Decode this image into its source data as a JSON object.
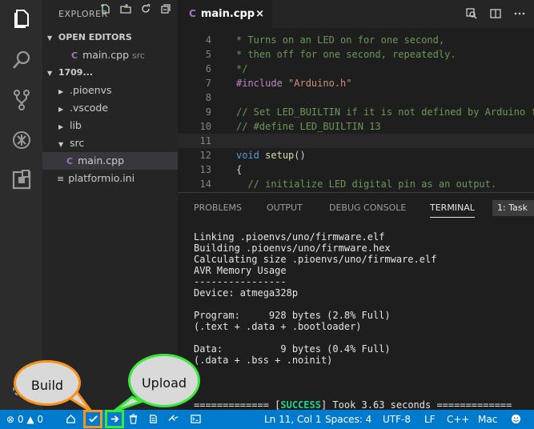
{
  "sidebar": {
    "title": "EXPLORER",
    "open_editors_label": "OPEN EDITORS",
    "open_file": {
      "icon_glyph": "C",
      "name": "main.cpp",
      "folder": "src"
    },
    "project_label": "1709...",
    "tree": [
      {
        "name": ".pioenvs",
        "kind": "folder",
        "expanded": false
      },
      {
        "name": ".vscode",
        "kind": "folder",
        "expanded": false
      },
      {
        "name": "lib",
        "kind": "folder",
        "expanded": false
      },
      {
        "name": "src",
        "kind": "folder",
        "expanded": true
      },
      {
        "name": "main.cpp",
        "kind": "cpp",
        "selected": true
      },
      {
        "name": "platformio.ini",
        "kind": "ini"
      }
    ]
  },
  "tab": {
    "icon_glyph": "C",
    "title": "main.cpp",
    "close": "×"
  },
  "editor": {
    "lines": [
      {
        "n": "4",
        "text": "* Turns on an LED on for one second,",
        "style": "com"
      },
      {
        "n": "5",
        "text": "* then off for one second, repeatedly.",
        "style": "com"
      },
      {
        "n": "6",
        "text": "*/",
        "style": "com"
      },
      {
        "n": "7",
        "text": "",
        "style": "include"
      },
      {
        "n": "8",
        "text": "",
        "style": "plain"
      },
      {
        "n": "9",
        "text": "// Set LED_BUILTIN if it is not defined by Arduino f",
        "style": "com"
      },
      {
        "n": "10",
        "text": "// #define LED_BUILTIN 13",
        "style": "com"
      },
      {
        "n": "11",
        "text": "",
        "style": "plain"
      },
      {
        "n": "12",
        "text": "",
        "style": "setup"
      },
      {
        "n": "13",
        "text": "{",
        "style": "plain"
      },
      {
        "n": "14",
        "text": "  // initialize LED digital pin as an output.",
        "style": "com"
      }
    ],
    "include_kw": "#include",
    "include_str": "\"Arduino.h\"",
    "setup_type": "void",
    "setup_fn": "setup",
    "setup_rest": "()"
  },
  "panel": {
    "tabs": [
      "PROBLEMS",
      "OUTPUT",
      "DEBUG CONSOLE",
      "TERMINAL"
    ],
    "active_tab": "TERMINAL",
    "terminal_select": "1: Task",
    "terminal_lines": [
      "Linking .pioenvs/uno/firmware.elf",
      "Building .pioenvs/uno/firmware.hex",
      "Calculating size .pioenvs/uno/firmware.elf",
      "AVR Memory Usage",
      "----------------",
      "Device: atmega328p",
      "",
      "Program:     928 bytes (2.8% Full)",
      "(.text + .data + .bootloader)",
      "",
      "Data:          9 bytes (0.4% Full)",
      "(.data + .bss + .noinit)"
    ],
    "success_prefix": "============= [",
    "success_word": "SUCCESS",
    "success_suffix": "] Took 3.63 seconds ============="
  },
  "status": {
    "errors": "0",
    "warnings": "0",
    "position": "Ln 11, Col 1",
    "spaces": "Spaces: 4",
    "encoding": "UTF-8",
    "eol": "LF",
    "language": "C++",
    "platform": "Mac"
  },
  "callouts": {
    "build": "Build",
    "upload": "Upload"
  },
  "colors": {
    "status_bar": "#007acc",
    "build_highlight": "#f7941d",
    "upload_highlight": "#39e839",
    "success": "#23d18b"
  }
}
